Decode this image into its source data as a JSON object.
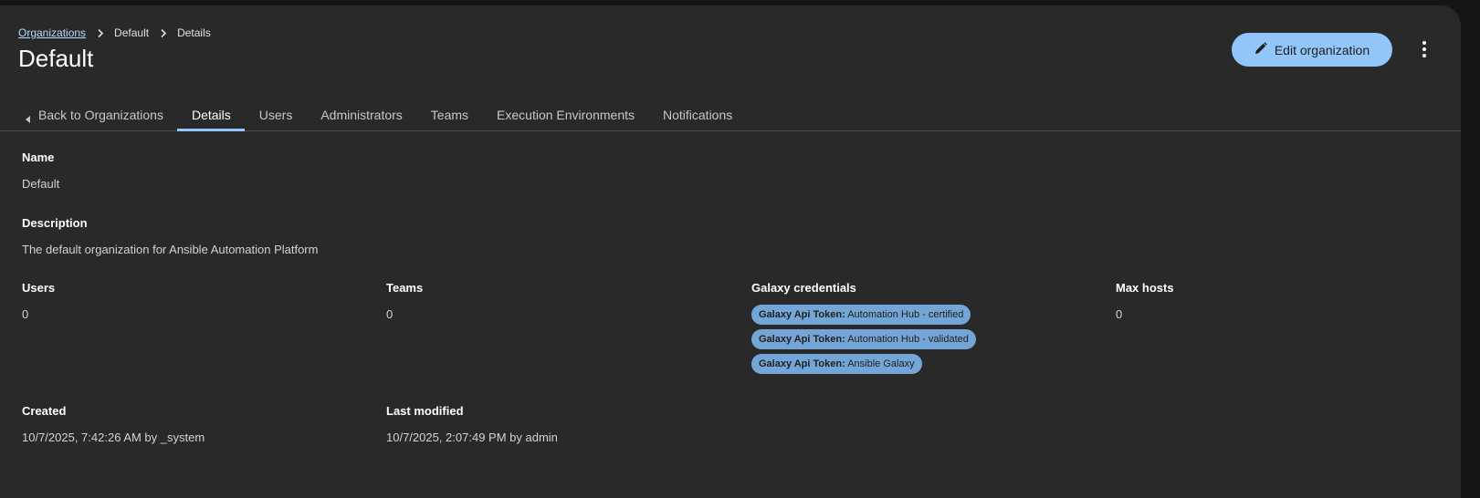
{
  "breadcrumb": {
    "items": [
      {
        "label": "Organizations"
      },
      {
        "label": "Default"
      },
      {
        "label": "Details"
      }
    ]
  },
  "page_title": "Default",
  "actions": {
    "edit_label": "Edit organization"
  },
  "tabs": [
    {
      "label": "Back to Organizations"
    },
    {
      "label": "Details"
    },
    {
      "label": "Users"
    },
    {
      "label": "Administrators"
    },
    {
      "label": "Teams"
    },
    {
      "label": "Execution Environments"
    },
    {
      "label": "Notifications"
    }
  ],
  "details": {
    "name": {
      "label": "Name",
      "value": "Default"
    },
    "description": {
      "label": "Description",
      "value": "The default organization for Ansible Automation Platform"
    },
    "users": {
      "label": "Users",
      "value": "0"
    },
    "teams": {
      "label": "Teams",
      "value": "0"
    },
    "galaxy": {
      "label": "Galaxy credentials",
      "credentials": [
        {
          "prefix": "Galaxy Api Token:",
          "name": "Automation Hub - certified"
        },
        {
          "prefix": "Galaxy Api Token:",
          "name": "Automation Hub - validated"
        },
        {
          "prefix": "Galaxy Api Token:",
          "name": "Ansible Galaxy"
        }
      ]
    },
    "max_hosts": {
      "label": "Max hosts",
      "value": "0"
    },
    "created": {
      "label": "Created",
      "value": "10/7/2025, 7:42:26 AM by _system"
    },
    "last_modified": {
      "label": "Last modified",
      "value": "10/7/2025, 2:07:49 PM by admin"
    }
  },
  "colors": {
    "background": "#292929",
    "accent": "#92c5f9",
    "chip": "#73a5d6",
    "link": "#b9dafc"
  },
  "icons": {
    "breadcrumb_separator": "chevron-right-icon",
    "edit": "pencil-icon",
    "kebab": "kebab-menu-icon",
    "back": "caret-left-icon"
  }
}
